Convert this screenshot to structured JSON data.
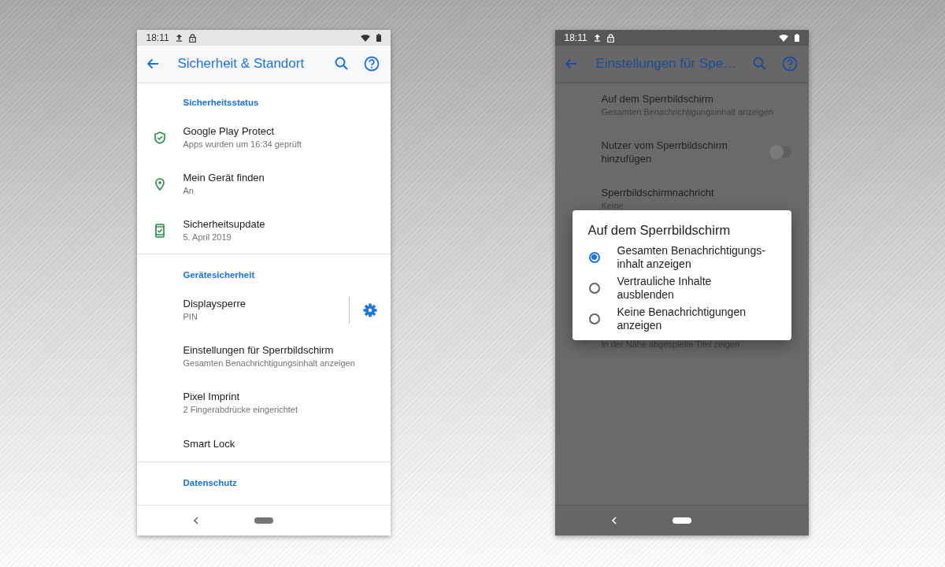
{
  "phones": [
    {
      "status_bar": {
        "time": "18:11"
      },
      "dimmed": false,
      "toolbar": {
        "title": "Sicherheit & Standort"
      },
      "sections": [
        {
          "header": "Sicherheitsstatus",
          "items": [
            {
              "kind": "shield",
              "title": "Google Play Protect",
              "subtitle": "Apps wurden um 16:34 geprüft"
            },
            {
              "kind": "pin",
              "title": "Mein Gerät finden",
              "subtitle": "An"
            },
            {
              "kind": "device",
              "title": "Sicherheitsupdate",
              "subtitle": "5. April 2019"
            }
          ]
        },
        {
          "header": "Gerätesicherheit",
          "items": [
            {
              "kind": "gear",
              "title": "Displaysperre",
              "subtitle": "PIN"
            },
            {
              "kind": "text",
              "title": "Einstellungen für Sperrbildschirm",
              "subtitle": "Gesamten Benachrichtigungsinhalt anzeigen"
            },
            {
              "kind": "text",
              "title": "Pixel Imprint",
              "subtitle": "2 Fingerabdrücke eingerichtet"
            },
            {
              "kind": "text",
              "title": "Smart Lock"
            }
          ]
        },
        {
          "header": "Datenschutz"
        }
      ]
    },
    {
      "status_bar": {
        "time": "18:11"
      },
      "dimmed": true,
      "toolbar": {
        "title": "Einstellungen für Spe…"
      },
      "sections": [
        {
          "items": [
            {
              "kind": "text",
              "title": "Auf dem Sperrbildschirm",
              "subtitle": "Gesamten Benachrichtigungsinhalt anzeigen"
            },
            {
              "kind": "switch",
              "title": "Nutzer vom Sperrbildschirm hinzufügen",
              "on": false
            },
            {
              "kind": "text",
              "title": "Sperrbildschirmnachricht",
              "subtitle": "Keine"
            },
            {
              "kind": "partial",
              "subtitle": "In der Nähe abgespielte Titel zeigen"
            }
          ]
        }
      ],
      "dialog": {
        "title": "Auf dem Sperrbildschirm",
        "options": [
          {
            "label": "Gesamten Benachrichtigungs-\ninhalt anzeigen",
            "selected": true
          },
          {
            "label": "Vertrauliche Inhalte\nausblenden",
            "selected": false
          },
          {
            "label": "Keine Benachrichtigungen\nanzeigen",
            "selected": false
          }
        ]
      }
    }
  ]
}
